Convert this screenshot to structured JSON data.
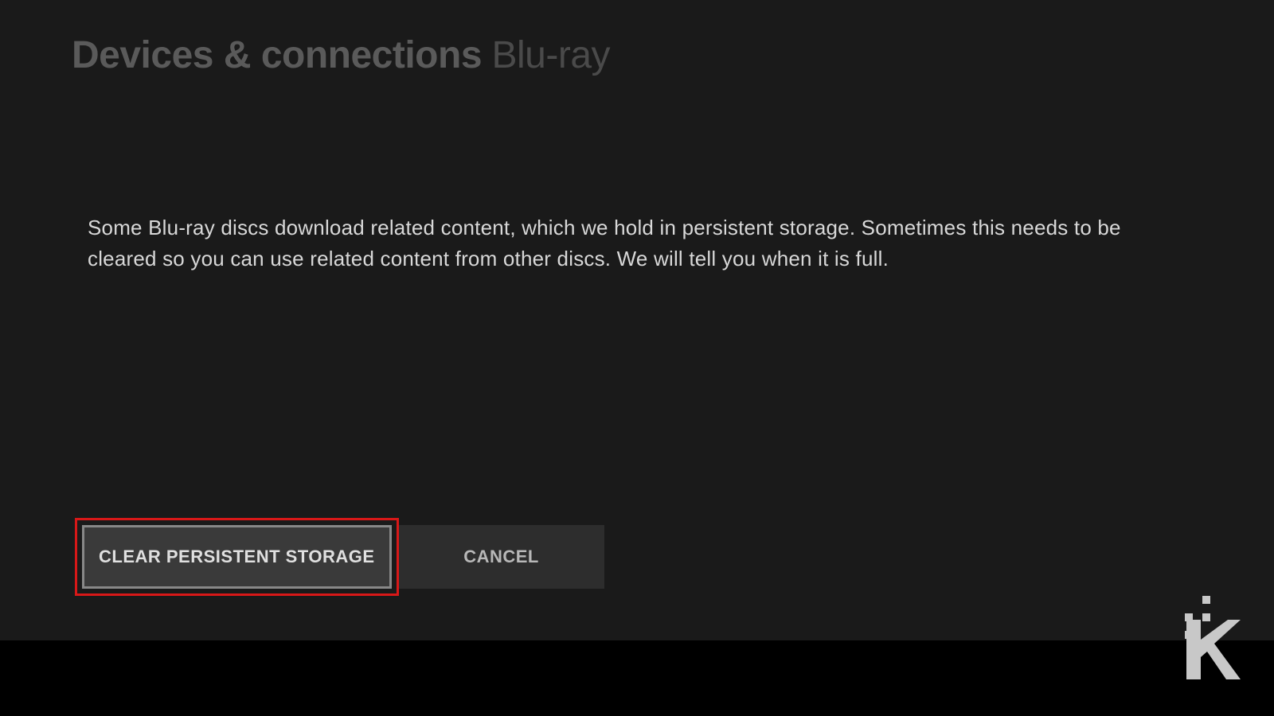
{
  "header": {
    "title": "Devices & connections",
    "subtitle": "Blu-ray"
  },
  "description": "Some Blu-ray discs download related content, which we hold in persistent storage.  Sometimes this needs to be cleared so you can use related content from other discs. We will tell you when it is full.",
  "buttons": {
    "primary": "CLEAR PERSISTENT STORAGE",
    "secondary": "CANCEL"
  },
  "highlight_color": "#d81818"
}
